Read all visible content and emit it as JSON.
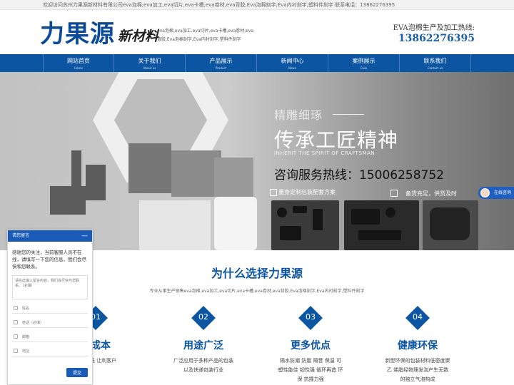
{
  "topbar": {
    "text": "欢迎访问苏州力果源新材料有限公司eva泡棉,eva加工,eva切片,eva卡槽,eva卷材,eva背胶,Eva泡棉刻字,Eva内衬刻字,塑料件刻字 联系电话：13862276395"
  },
  "header": {
    "logo_main": "力果源",
    "logo_sub": "新材料",
    "desc": "eva泡棉,eva加工,eva切片,eva卡槽,eva卷材,eva背胶,Eva泡棉刻字,Eva内衬刻字,塑料件刻字",
    "hotline_label": "EVA泡棉生产及加工热线:",
    "hotline_number": "13862276395"
  },
  "nav": {
    "items": [
      {
        "cn": "网站首页",
        "en": "Home"
      },
      {
        "cn": "关于我们",
        "en": "About us"
      },
      {
        "cn": "产品展示",
        "en": "Product"
      },
      {
        "cn": "新闻中心",
        "en": "News"
      },
      {
        "cn": "案例展示",
        "en": "Case"
      },
      {
        "cn": "联系我们",
        "en": "Contact us"
      }
    ]
  },
  "banner": {
    "tag": "精雕细琢",
    "headline": "传承工匠精神",
    "en_line": "INHERIT THE SPIRIT OF CRAFTSMAN",
    "tel_label": "咨询服务热线：",
    "tel_number": "15006258752",
    "feature_1": "量身定制包装配套方案",
    "feature_2": "备货充足，供货及时"
  },
  "chat_button": {
    "label": "在线咨询"
  },
  "section": {
    "title": "为什么选择力果源",
    "subtitle": "专业从事生产销售eva泡棉,eva加工,eva切片,eva卡槽,eva卷材,eva背胶,Eva泡棉刻字,Eva内衬刻字,塑料件刻字"
  },
  "features": [
    {
      "num": "01",
      "title": "低成本",
      "desc": "成本更低 让利客户"
    },
    {
      "num": "02",
      "title": "用途广泛",
      "desc": "广泛应用于多种产品的包装 以及快递包装行业"
    },
    {
      "num": "03",
      "title": "更多优点",
      "desc": "隔水防潮 防震 隔音 保温 可塑性能佳 韧性强 循环再造 环保 抗撞力强"
    },
    {
      "num": "04",
      "title": "健康环保",
      "desc": "新型环保的包装材料低密度聚乙 烯脂经物理发泡产生无数 的独立气泡构成"
    }
  ],
  "chat_panel": {
    "header": "请您留言",
    "minimize": "—",
    "message": "感谢您的关注，当前客服人员不在线，请填写一下您的信息，我们会尽快和您联系。",
    "textarea_placeholder": "请在此输入留言内容，我们会尽快与您联系。（必填）",
    "name_placeholder": "姓名",
    "phone_placeholder": "电话（必填）",
    "email_placeholder": "邮箱",
    "address_placeholder": "地址",
    "submit_label": "提交"
  },
  "colors": {
    "brand_blue": "#0b55a3",
    "logo_blue": "#0b4a97",
    "hotline_blue": "#1b5fa8",
    "chat_blue": "#1a5bb8"
  }
}
